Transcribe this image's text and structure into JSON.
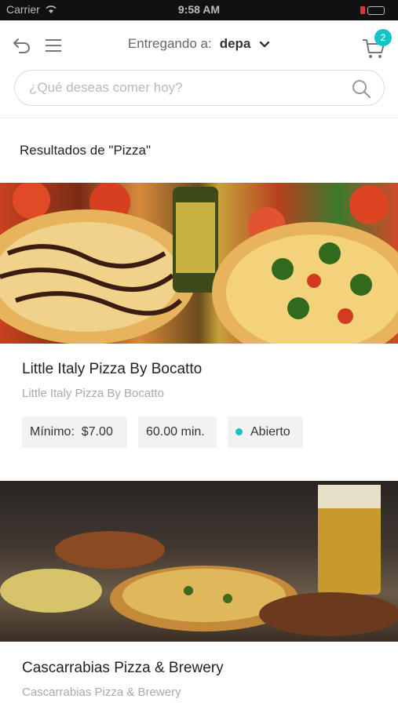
{
  "status_bar": {
    "carrier": "Carrier",
    "time": "9:58 AM"
  },
  "header": {
    "deliver_label": "Entregando a:",
    "location": "depa",
    "cart_count": "2"
  },
  "search": {
    "placeholder": "¿Qué deseas comer hoy?",
    "value": ""
  },
  "results": {
    "heading": "Resultados de \"Pizza\""
  },
  "restaurants": [
    {
      "name": "Little Italy Pizza By Bocatto",
      "subtitle": "Little Italy Pizza By Bocatto",
      "minimum_label": "Mínimo:",
      "minimum_value": "$7.00",
      "time": "60.00 min.",
      "status": "Abierto"
    },
    {
      "name": "Cascarrabias Pizza & Brewery",
      "subtitle": "Cascarrabias Pizza & Brewery"
    }
  ],
  "colors": {
    "accent": "#17c2c6",
    "chip_bg": "#f2f2f2"
  }
}
